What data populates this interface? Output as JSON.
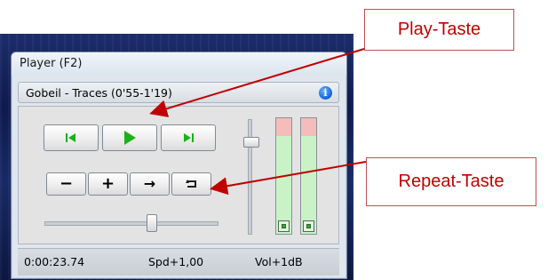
{
  "window": {
    "title": "Player (F2)"
  },
  "track": {
    "name": "Gobeil - Traces (0'55-1'19)"
  },
  "icons": {
    "info": "info-icon",
    "prev": "skip-back-icon",
    "play": "play-icon",
    "next": "skip-forward-icon",
    "minus": "minus-icon",
    "plus": "plus-icon",
    "arrow": "arrow-right-icon",
    "repeat": "repeat-icon"
  },
  "buttons": {
    "info_glyph": "i",
    "minus": "−",
    "plus": "+",
    "arrow": "→"
  },
  "status": {
    "time": "0:00:23.74",
    "speed": "Spd+1,00",
    "volume": "Vol+1dB"
  },
  "annotations": {
    "play": "Play-Taste",
    "repeat": "Repeat-Taste"
  },
  "colors": {
    "play_green": "#19b219",
    "meter_green": "#c9f2c6",
    "meter_peak": "#f5bcbc",
    "callout_text": "#c00000",
    "callout_border": "#c0504d"
  }
}
